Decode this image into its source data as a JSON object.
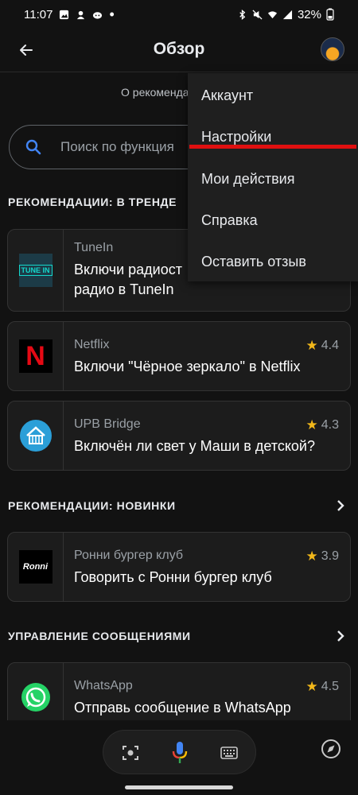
{
  "status_bar": {
    "time": "11:07",
    "battery": "32%"
  },
  "header": {
    "title": "Обзор"
  },
  "subtitle": "О рекоменда",
  "search": {
    "placeholder": "Поиск по функция"
  },
  "sections": {
    "trending": "РЕКОМЕНДАЦИИ: В ТРЕНДЕ",
    "new": "РЕКОМЕНДАЦИИ: НОВИНКИ",
    "messaging": "УПРАВЛЕНИЕ СООБЩЕНИЯМИ"
  },
  "cards": [
    {
      "provider": "TuneIn",
      "text": "Включи радиост радио в TuneIn",
      "line1": "Включи радиост",
      "line2": "радио в TuneIn",
      "logo_text": "TUNE IN"
    },
    {
      "provider": "Netflix",
      "text": "Включи \"Чёрное зеркало\" в Netflix",
      "rating": "4.4",
      "logo_text": "N"
    },
    {
      "provider": "UPB Bridge",
      "text": "Включён ли свет у Маши в детской?",
      "rating": "4.3"
    },
    {
      "provider": "Ронни бургер клуб",
      "text": "Говорить с Ронни бургер клуб",
      "rating": "3.9",
      "logo_text": "Ronni"
    },
    {
      "provider": "WhatsApp",
      "text": "Отправь сообщение в WhatsApp",
      "rating": "4.5"
    }
  ],
  "menu": {
    "items": [
      "Аккаунт",
      "Настройки",
      "Мои действия",
      "Справка",
      "Оставить отзыв"
    ]
  },
  "colors": {
    "accent_blue": "#4285f4",
    "star": "#f2b81a",
    "highlight_red": "#e01010",
    "netflix_red": "#e50914",
    "whatsapp_green": "#25d366",
    "upb_blue": "#2b9fd8"
  },
  "icons": [
    "back-arrow-icon",
    "search-icon",
    "chevron-right-icon",
    "star-icon",
    "lens-icon",
    "microphone-icon",
    "keyboard-icon",
    "compass-icon"
  ]
}
